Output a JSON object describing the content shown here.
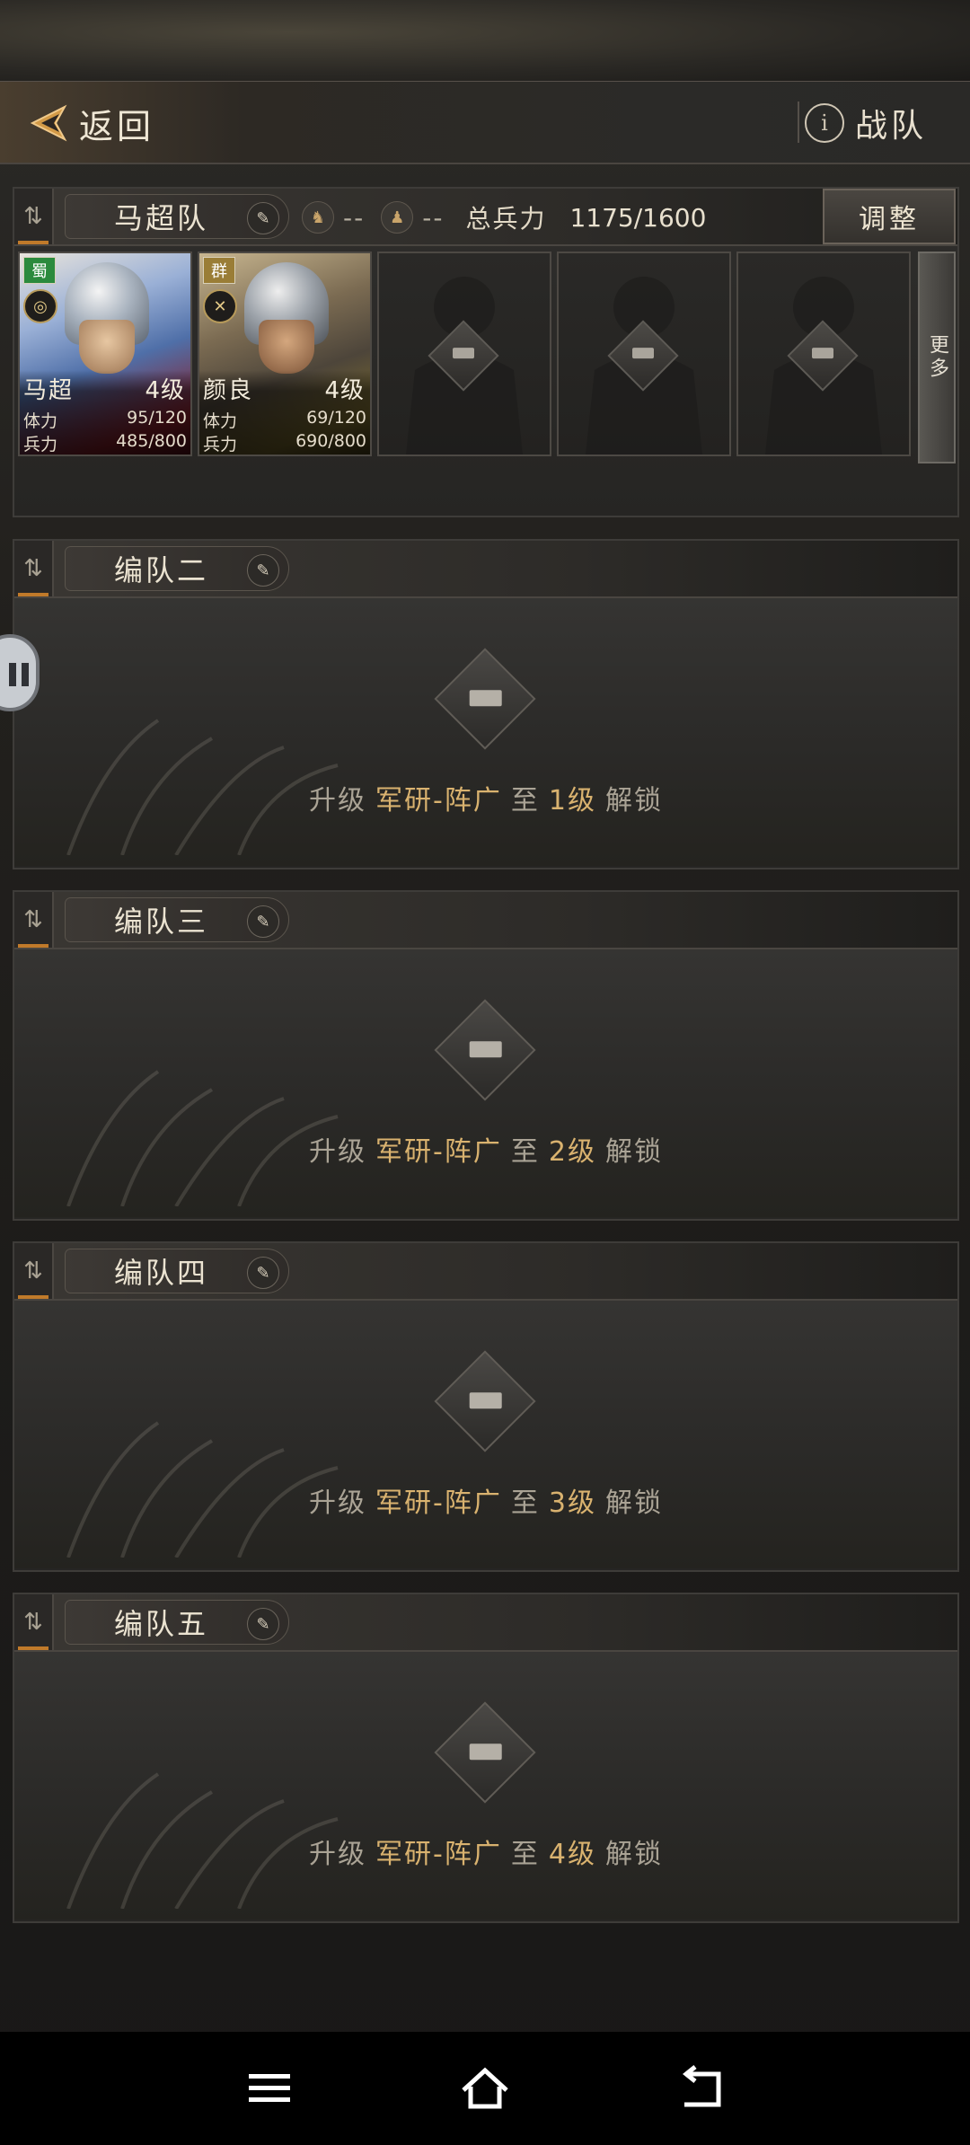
{
  "header": {
    "back_label": "返回",
    "team_label": "战队",
    "info_icon": "i"
  },
  "squad_main": {
    "name": "马超队",
    "dash1": "--",
    "dash2": "--",
    "total_label": "总兵力",
    "total_value": "1175/1600",
    "adjust_label": "调整",
    "more_label": "更多",
    "heroes": [
      {
        "name": "马超",
        "level": "4级",
        "faction": "蜀",
        "stat1_label": "体力",
        "stat1_value": "95/120",
        "stat2_label": "兵力",
        "stat2_value": "485/800"
      },
      {
        "name": "颜良",
        "level": "4级",
        "faction": "群",
        "stat1_label": "体力",
        "stat1_value": "69/120",
        "stat2_label": "兵力",
        "stat2_value": "690/800"
      }
    ]
  },
  "locked_squads": [
    {
      "name": "编队二",
      "prefix": "升级",
      "tech": "军研-阵广",
      "to": "至",
      "level": "1级",
      "suffix": "解锁"
    },
    {
      "name": "编队三",
      "prefix": "升级",
      "tech": "军研-阵广",
      "to": "至",
      "level": "2级",
      "suffix": "解锁"
    },
    {
      "name": "编队四",
      "prefix": "升级",
      "tech": "军研-阵广",
      "to": "至",
      "level": "3级",
      "suffix": "解锁"
    },
    {
      "name": "编队五",
      "prefix": "升级",
      "tech": "军研-阵广",
      "to": "至",
      "level": "4级",
      "suffix": "解锁"
    }
  ],
  "colors": {
    "accent_gold": "#d9b26f",
    "sort_marker": "#c07a2a",
    "shu_green": "#2b8a3d"
  }
}
